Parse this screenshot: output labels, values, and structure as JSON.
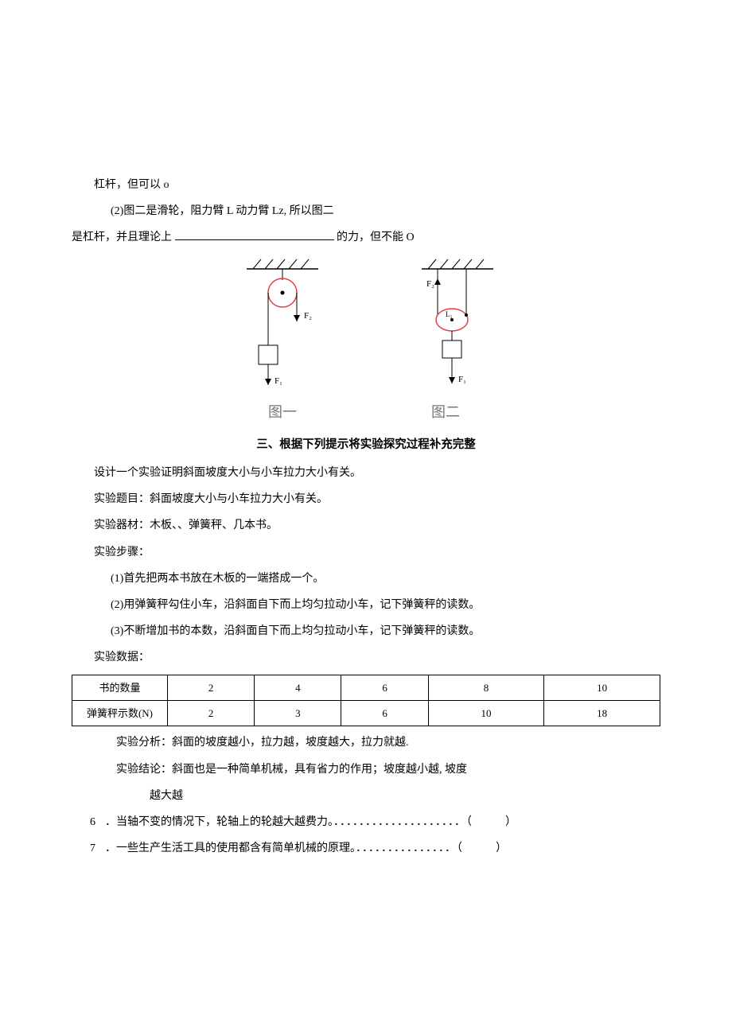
{
  "line1": "杠杆，但可以 o",
  "line2": "(2)图二是滑轮，阻力臂 L 动力臂 Lz, 所以图二",
  "line3_pre": "是杠杆，并且理论上 ",
  "line3_post": "的力，但不能 O",
  "fig1_label": "图一",
  "fig2_label": "图二",
  "section_title": "三、根据下列提示将实验探究过程补充完整",
  "p_design": "设计一个实验证明斜面坡度大小与小车拉力大小有关。",
  "p_topic": "实验题目：斜面坡度大小与小车拉力大小有关。",
  "p_equip": "实验器材：木板、、弹簧秤、几本书。",
  "p_steps": "实验步骤：",
  "step1": "(1)首先把两本书放在木板的一端搭成一个。",
  "step2": "(2)用弹簧秤勾住小车，沿斜面自下而上均匀拉动小车，记下弹簧秤的读数。",
  "step3": "(3)不断增加书的本数，沿斜面自下而上均匀拉动小车，记下弹簧秤的读数。",
  "p_data": "实验数据：",
  "table": {
    "header_row": [
      "书的数量",
      "2",
      "4",
      "6",
      "8",
      "10"
    ],
    "data_row": [
      "弹簧秤示数(N)",
      "2",
      "3",
      "6",
      "10",
      "18"
    ]
  },
  "p_analysis": "实验分析：斜面的坡度越小，拉力越，坡度越大，拉力就越.",
  "p_conclusion1": "实验结论：斜面也是一种简单机械，具有省力的作用；坡度越小越, 坡度",
  "p_conclusion2": "越大越",
  "q6_num": "6",
  "q6_body": "．当轴不变的情况下，轮轴上的轮越大越费力。",
  "q6_dots": "．．．．．．．．．．．．．．．．．．．．",
  "q6_paren": "（　　　）",
  "q7_num": "7",
  "q7_body": "．一些生产生活工具的使用都含有简单机械的原理。",
  "q7_dots": "．．．．．．．．．．．．．．．",
  "q7_paren": "（　　　）"
}
